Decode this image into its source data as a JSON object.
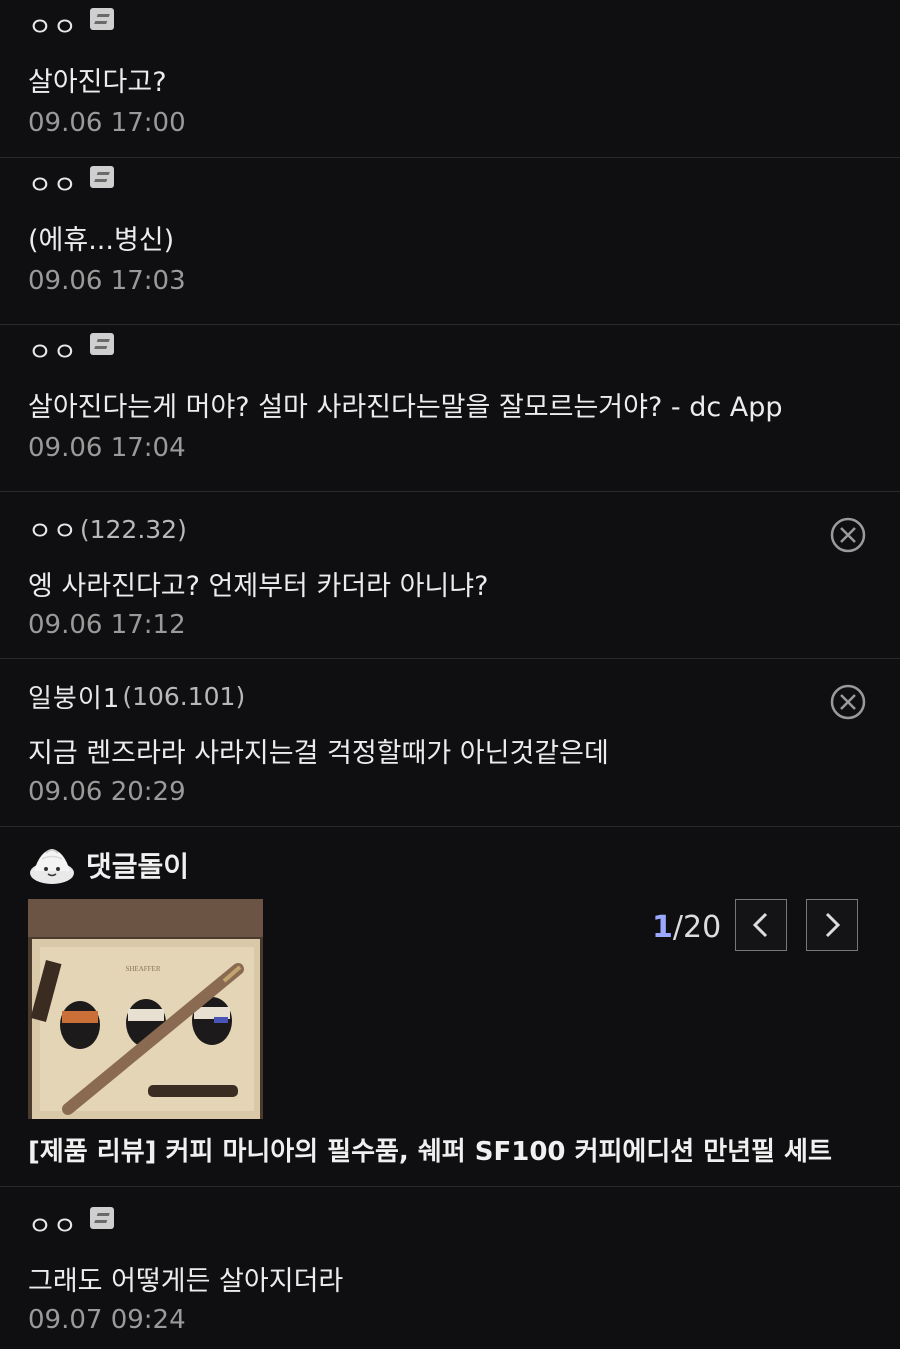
{
  "comments": [
    {
      "nick": "ㅇㅇ",
      "ip": "",
      "text": "살아진다고?",
      "time": "09.06 17:00"
    },
    {
      "nick": "ㅇㅇ",
      "ip": "",
      "text": "(에휴...병신)",
      "time": "09.06 17:03"
    },
    {
      "nick": "ㅇㅇ",
      "ip": "",
      "text": "살아진다는게 머야? 설마 사라진다는말을 잘모르는거야? - dc App",
      "time": "09.06 17:04"
    },
    {
      "nick": "ㅇㅇ",
      "ip": "(122.32)",
      "text": "엥 사라진다고? 언제부터 카더라 아니냐?",
      "time": "09.06 17:12"
    },
    {
      "nick": "일붕이1",
      "ip": "(106.101)",
      "text": "지금 렌즈라라 사라지는걸 걱정할때가 아닌것같은데",
      "time": "09.06 20:29"
    },
    {
      "nick": "ㅇㅇ",
      "ip": "",
      "text": "그래도 어떻게든 살아지더라",
      "time": "09.07 09:24"
    }
  ],
  "ad": {
    "title": "댓글돌이",
    "pager_current": "1",
    "pager_total": "/20",
    "caption": "[제품 리뷰] 커피 마니아의 필수품, 쉐퍼 SF100 커피에디션 만년필 세트",
    "thumb_brand": "SHEAFFER"
  },
  "icons": {
    "app_badge": "dc-app-icon",
    "delete": "delete-circle-x-icon",
    "mascot": "dumpling-mascot-icon",
    "prev": "chevron-left-icon",
    "next": "chevron-right-icon"
  }
}
